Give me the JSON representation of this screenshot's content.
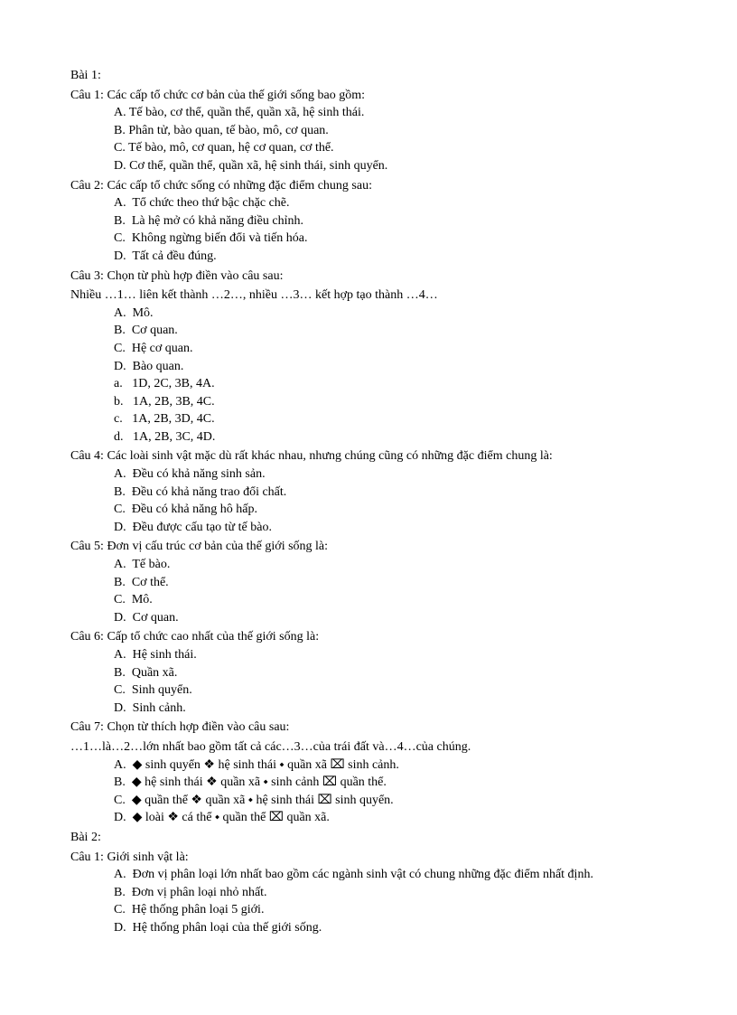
{
  "bai1": {
    "title": "Bài 1:",
    "q1": {
      "q": "Câu 1: Các cấp tổ chức cơ bản của thế giới sống bao gồm:",
      "a": "A. Tế bào, cơ thể, quần thể, quần xã, hệ sinh thái.",
      "b": "B. Phân tử, bào quan, tế bào, mô, cơ quan.",
      "c": "C. Tế bào, mô, cơ quan, hệ cơ quan, cơ thể.",
      "d": "D. Cơ thể, quần thể, quần xã, hệ sinh thái, sinh quyển."
    },
    "q2": {
      "q": "Câu 2: Các cấp tổ chức sống có những đặc điểm chung sau:",
      "a": "A.  Tổ chức theo thứ bậc chặc chẽ.",
      "b": "B.  Là hệ mở có khả năng điều chỉnh.",
      "c": "C.  Không ngừng biến đổi và tiến hóa.",
      "d": "D.  Tất cả đều đúng."
    },
    "q3": {
      "q": "Câu 3: Chọn từ phù hợp điền vào câu sau:",
      "fill": "Nhiều …1… liên kết thành …2…, nhiều …3… kết hợp tạo thành …4…",
      "a": "A.  Mô.",
      "b": "B.  Cơ quan.",
      "c": "C.  Hệ cơ quan.",
      "d": "D.  Bào quan.",
      "aa": "a.   1D, 2C, 3B, 4A.",
      "bb": "b.   1A, 2B, 3B, 4C.",
      "cc": "c.   1A, 2B, 3D, 4C.",
      "dd": "d.   1A, 2B, 3C, 4D."
    },
    "q4": {
      "q": "Câu 4: Các loài sinh vật mặc dù rất khác nhau, nhưng chúng cũng có những đặc điểm chung là:",
      "a": "A.  Đều có khả năng sinh sản.",
      "b": "B.  Đều có khả năng trao đổi chất.",
      "c": "C.  Đều có khả năng hô hấp.",
      "d": "D.  Đều được cấu tạo từ tế bào."
    },
    "q5": {
      "q": "Câu 5: Đơn vị cấu trúc cơ bản của thế giới sống là:",
      "a": "A.  Tế bào.",
      "b": "B.  Cơ thể.",
      "c": "C.  Mô.",
      "d": "D.  Cơ quan."
    },
    "q6": {
      "q": "Câu 6: Cấp tổ chức cao nhất của thế giới sống là:",
      "a": "A.  Hệ sinh thái.",
      "b": "B.  Quần xã.",
      "c": "C.  Sinh quyển.",
      "d": "D.  Sinh cảnh."
    },
    "q7": {
      "q": "Câu 7: Chọn từ thích hợp điền vào câu sau:",
      "fill": "…1…là…2…lớn nhất bao gồm tất cả các…3…của trái đất và…4…của chúng.",
      "a": "A.  ◆ sinh quyển ❖ hệ sinh thái ⬩ quần xã ⌧ sinh cảnh.",
      "b": "B.  ◆ hệ sinh thái ❖ quần xã ⬩ sinh cảnh ⌧ quần thể.",
      "c": "C.  ◆ quần thể ❖ quần xã ⬩ hệ sinh thái ⌧ sinh quyển.",
      "d": "D.  ◆ loài ❖ cá thể ⬩ quần thể ⌧ quần xã."
    }
  },
  "bai2": {
    "title": "Bài 2:",
    "q1": {
      "q": "Câu 1: Giới sinh vật là:",
      "a": "A.  Đơn vị phân loại lớn nhất bao gồm các ngành sinh vật có chung những đặc điểm nhất định.",
      "b": "B.  Đơn vị phân loại nhỏ nhất.",
      "c": "C.  Hệ thống phân loại 5 giới.",
      "d": "D.  Hệ thống phân loại của thế giới sống."
    }
  }
}
